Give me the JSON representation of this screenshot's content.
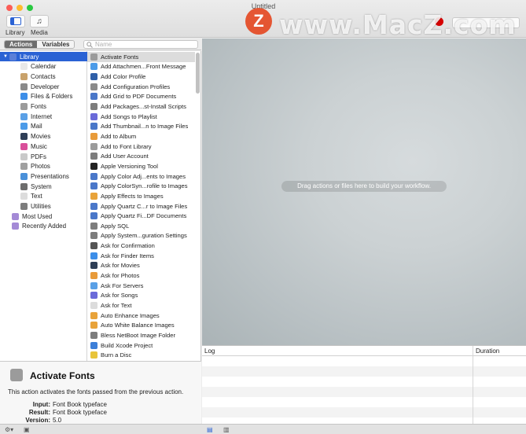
{
  "window": {
    "title": "Untitled"
  },
  "toolbar": {
    "library_label": "Library",
    "media_label": "Media"
  },
  "watermark": {
    "logo": "Z",
    "text": "www.MacZ.com"
  },
  "tabs": {
    "actions": "Actions",
    "variables": "Variables",
    "search_placeholder": "Name"
  },
  "library": [
    {
      "label": "Library",
      "icon": "library-icon",
      "color": "#5b7fd8",
      "selected": true
    },
    {
      "label": "Calendar",
      "icon": "calendar-icon",
      "color": "#e8e8e8"
    },
    {
      "label": "Contacts",
      "icon": "contacts-icon",
      "color": "#c9a26b"
    },
    {
      "label": "Developer",
      "icon": "developer-icon",
      "color": "#8a8a8a"
    },
    {
      "label": "Files & Folders",
      "icon": "finder-icon",
      "color": "#3d8ee8"
    },
    {
      "label": "Fonts",
      "icon": "fonts-icon",
      "color": "#9b9b9b"
    },
    {
      "label": "Internet",
      "icon": "internet-icon",
      "color": "#5aa0e6"
    },
    {
      "label": "Mail",
      "icon": "mail-icon",
      "color": "#4c9be8"
    },
    {
      "label": "Movies",
      "icon": "movies-icon",
      "color": "#2f3f57"
    },
    {
      "label": "Music",
      "icon": "music-icon",
      "color": "#d94f9a"
    },
    {
      "label": "PDFs",
      "icon": "pdf-icon",
      "color": "#c9c9c9"
    },
    {
      "label": "Photos",
      "icon": "photos-icon",
      "color": "#a0a0a0"
    },
    {
      "label": "Presentations",
      "icon": "presentations-icon",
      "color": "#4a90d9"
    },
    {
      "label": "System",
      "icon": "system-icon",
      "color": "#6d6d6d"
    },
    {
      "label": "Text",
      "icon": "text-icon",
      "color": "#dcdcdc"
    },
    {
      "label": "Utilities",
      "icon": "utilities-icon",
      "color": "#7d7d7d"
    },
    {
      "label": "Most Used",
      "icon": "folder-icon",
      "color": "#a48ad6"
    },
    {
      "label": "Recently Added",
      "icon": "folder-icon",
      "color": "#a48ad6"
    }
  ],
  "actions": [
    {
      "label": "Activate Fonts",
      "icon": "fonts-icon",
      "color": "#9b9b9b",
      "selected": true
    },
    {
      "label": "Add Attachmen...Front Message",
      "icon": "mail-icon",
      "color": "#4c9be8"
    },
    {
      "label": "Add Color Profile",
      "icon": "color-icon",
      "color": "#2f5fa8"
    },
    {
      "label": "Add Configuration Profiles",
      "icon": "config-icon",
      "color": "#8a8a8a"
    },
    {
      "label": "Add Grid to PDF Documents",
      "icon": "pdf-icon",
      "color": "#4a77c9"
    },
    {
      "label": "Add Packages...st-Install Scripts",
      "icon": "package-icon",
      "color": "#7d7d7d"
    },
    {
      "label": "Add Songs to Playlist",
      "icon": "music-icon",
      "color": "#6a6ad9"
    },
    {
      "label": "Add Thumbnail...n to Image Files",
      "icon": "image-icon",
      "color": "#4a77c9"
    },
    {
      "label": "Add to Album",
      "icon": "photos-icon",
      "color": "#e89b3a"
    },
    {
      "label": "Add to Font Library",
      "icon": "fonts-icon",
      "color": "#9b9b9b"
    },
    {
      "label": "Add User Account",
      "icon": "user-icon",
      "color": "#7d7d7d"
    },
    {
      "label": "Apple Versioning Tool",
      "icon": "terminal-icon",
      "color": "#222222"
    },
    {
      "label": "Apply Color Adj...ents to Images",
      "icon": "color-icon",
      "color": "#4a77c9"
    },
    {
      "label": "Apply ColorSyn...rofile to Images",
      "icon": "color-icon",
      "color": "#4a77c9"
    },
    {
      "label": "Apply Effects to Images",
      "icon": "effects-icon",
      "color": "#e8a33a"
    },
    {
      "label": "Apply Quartz C...r to Image Files",
      "icon": "quartz-icon",
      "color": "#4a77c9"
    },
    {
      "label": "Apply Quartz Fi...DF Documents",
      "icon": "quartz-icon",
      "color": "#4a77c9"
    },
    {
      "label": "Apply SQL",
      "icon": "sql-icon",
      "color": "#7d7d7d"
    },
    {
      "label": "Apply System...guration Settings",
      "icon": "system-icon",
      "color": "#7d7d7d"
    },
    {
      "label": "Ask for Confirmation",
      "icon": "robot-icon",
      "color": "#555555"
    },
    {
      "label": "Ask for Finder Items",
      "icon": "finder-icon",
      "color": "#3d8ee8"
    },
    {
      "label": "Ask for Movies",
      "icon": "movies-icon",
      "color": "#2f3f57"
    },
    {
      "label": "Ask for Photos",
      "icon": "photos-icon",
      "color": "#e89b3a"
    },
    {
      "label": "Ask For Servers",
      "icon": "internet-icon",
      "color": "#5aa0e6"
    },
    {
      "label": "Ask for Songs",
      "icon": "music-icon",
      "color": "#6a6ad9"
    },
    {
      "label": "Ask for Text",
      "icon": "text-icon",
      "color": "#dcdcdc"
    },
    {
      "label": "Auto Enhance Images",
      "icon": "effects-icon",
      "color": "#e8a33a"
    },
    {
      "label": "Auto White Balance Images",
      "icon": "effects-icon",
      "color": "#e8a33a"
    },
    {
      "label": "Bless NetBoot Image Folder",
      "icon": "package-icon",
      "color": "#7d7d7d"
    },
    {
      "label": "Build Xcode Project",
      "icon": "xcode-icon",
      "color": "#3d7fd8"
    },
    {
      "label": "Burn a Disc",
      "icon": "disc-icon",
      "color": "#e8c43a"
    }
  ],
  "workflow": {
    "hint": "Drag actions or files here to build your workflow."
  },
  "log": {
    "col_log": "Log",
    "col_duration": "Duration"
  },
  "description": {
    "title": "Activate Fonts",
    "text": "This action activates the fonts passed from the previous action.",
    "input_label": "Input:",
    "input_value": "Font Book typeface",
    "result_label": "Result:",
    "result_value": "Font Book typeface",
    "version_label": "Version:",
    "version_value": "5.0"
  }
}
